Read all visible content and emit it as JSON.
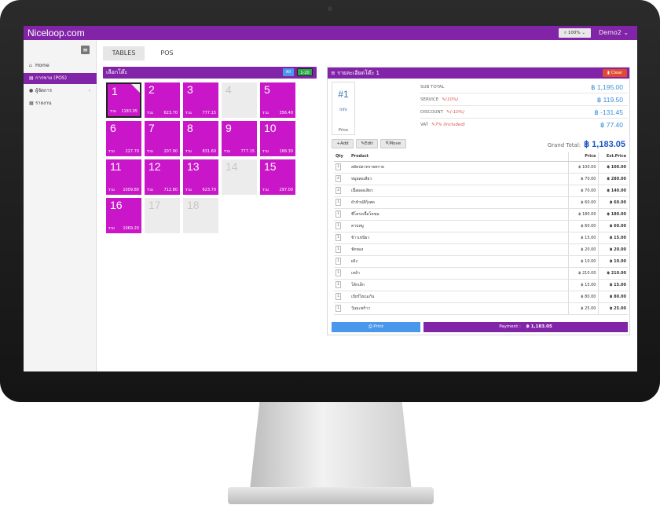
{
  "app": {
    "brand": "Niceloop.com",
    "zoom": "100%",
    "user": "Demo2"
  },
  "sidebar": {
    "items": [
      {
        "label": "Home",
        "icon": "home-icon"
      },
      {
        "label": "การขาย (POS)",
        "icon": "cart-icon"
      },
      {
        "label": "ผู้จัดการ",
        "icon": "user-icon"
      },
      {
        "label": "รายงาน",
        "icon": "report-icon"
      }
    ]
  },
  "tabs": [
    {
      "label": "TABLES"
    },
    {
      "label": "POS"
    }
  ],
  "tables_panel": {
    "title": "เลือกโต๊ะ",
    "filter_all": "All",
    "filter_range": "1-20"
  },
  "tables": [
    {
      "num": "1",
      "label": "รวม",
      "amount": "1183.05",
      "active": true
    },
    {
      "num": "2",
      "label": "รวม",
      "amount": "623.70",
      "active": true
    },
    {
      "num": "3",
      "label": "รวม",
      "amount": "777.15",
      "active": true
    },
    {
      "num": "4",
      "label": "",
      "amount": "",
      "active": false
    },
    {
      "num": "5",
      "label": "รวม",
      "amount": "356.40",
      "active": true
    },
    {
      "num": "6",
      "label": "รวม",
      "amount": "227.70",
      "active": true
    },
    {
      "num": "7",
      "label": "รวม",
      "amount": "207.90",
      "active": true
    },
    {
      "num": "8",
      "label": "รวม",
      "amount": "831.60",
      "active": true
    },
    {
      "num": "9",
      "label": "รวม",
      "amount": "777.15",
      "active": true
    },
    {
      "num": "10",
      "label": "รวม",
      "amount": "168.30",
      "active": true
    },
    {
      "num": "11",
      "label": "รวม",
      "amount": "1009.80",
      "active": true
    },
    {
      "num": "12",
      "label": "รวม",
      "amount": "712.80",
      "active": true
    },
    {
      "num": "13",
      "label": "รวม",
      "amount": "623.70",
      "active": true
    },
    {
      "num": "14",
      "label": "",
      "amount": "",
      "active": false
    },
    {
      "num": "15",
      "label": "รวม",
      "amount": "297.00",
      "active": true
    },
    {
      "num": "16",
      "label": "รวม",
      "amount": "1069.20",
      "active": true
    },
    {
      "num": "17",
      "label": "",
      "amount": "",
      "active": false
    },
    {
      "num": "18",
      "label": "",
      "amount": "",
      "active": false
    }
  ],
  "detail": {
    "title": "รายละเอียดโต๊ะ 1",
    "clear": "Clear",
    "table_no": "#1",
    "info": "Info",
    "price_tab": "Price",
    "subtotal_label": "SUB TOTAL",
    "subtotal": "฿ 1,195.00",
    "service_label": "SERVICE",
    "service_note": "(10%)",
    "service": "฿ 119.50",
    "discount_label": "DISCOUNT",
    "discount_note": "(-10%)",
    "discount": "฿ -131.45",
    "vat_label": "VAT",
    "vat_note": "7% (Included)",
    "vat": "฿ 77.40",
    "add": "+Add",
    "edit": "Edit",
    "move": "Move",
    "grand_label": "Grand Total:",
    "grand": "฿ 1,183.05",
    "col_qty": "Qty",
    "col_product": "Product",
    "col_price": "Price",
    "col_ext": "Ext.Price",
    "items": [
      {
        "qty": "1",
        "product": "สลัดปลาทรายทราย",
        "price": "฿ 100.00",
        "ext": "฿ 100.00"
      },
      {
        "qty": "4",
        "product": "หมูผลอเลียว",
        "price": "฿ 70.00",
        "ext": "฿ 280.00"
      },
      {
        "qty": "2",
        "product": "เนื้อผลอเลียว",
        "price": "฿ 70.00",
        "ext": "฿ 140.00"
      },
      {
        "qty": "1",
        "product": "ยำหัวปลีกุ้งสด",
        "price": "฿ 60.00",
        "ext": "฿ 60.00"
      },
      {
        "qty": "1",
        "product": "ซี่โครงเนื้อโคขุน",
        "price": "฿ 180.00",
        "ext": "฿ 180.00"
      },
      {
        "qty": "1",
        "product": "คาบหมู",
        "price": "฿ 60.00",
        "ext": "฿ 60.00"
      },
      {
        "qty": "1",
        "product": "ข้าวเหนียว",
        "price": "฿ 15.00",
        "ext": "฿ 15.00"
      },
      {
        "qty": "1",
        "product": "ฟักทอง",
        "price": "฿ 20.00",
        "ext": "฿ 20.00"
      },
      {
        "qty": "1",
        "product": "ผงิง",
        "price": "฿ 10.00",
        "ext": "฿ 10.00"
      },
      {
        "qty": "1",
        "product": "เหล้า",
        "price": "฿ 210.00",
        "ext": "฿ 210.00"
      },
      {
        "qty": "1",
        "product": "โค้กเล็ก",
        "price": "฿ 15.00",
        "ext": "฿ 15.00"
      },
      {
        "qty": "1",
        "product": "เบียร์ไฮเนเก้น",
        "price": "฿ 80.00",
        "ext": "฿ 80.00"
      },
      {
        "qty": "1",
        "product": "วุ้นมะพร้าว",
        "price": "฿ 25.00",
        "ext": "฿ 25.00"
      }
    ],
    "print": "Print",
    "payment_label": "Payment :",
    "payment_amount": "฿ 1,183.05"
  }
}
